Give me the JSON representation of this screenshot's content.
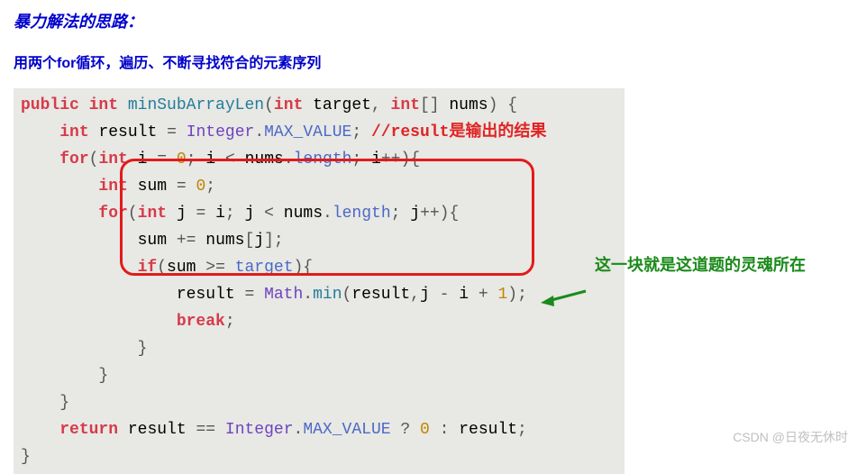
{
  "title": "暴力解法的思路：",
  "subtitle": "用两个for循环，遍历、不断寻找符合的元素序列",
  "annotation": "这一块就是这道题的灵魂所在",
  "watermark": "CSDN @日夜无休时",
  "code": {
    "comment_result": "//result是输出的结果",
    "kw_public": "public",
    "kw_int": "int",
    "method_name": "minSubArrayLen",
    "param_target": "target",
    "param_nums": "nums",
    "var_result": "result",
    "class_integer": "Integer",
    "prop_max": "MAX_VALUE",
    "kw_for": "for",
    "var_i": "i",
    "var_j": "j",
    "num_zero": "0",
    "num_one": "1",
    "prop_length": "length",
    "var_sum": "sum",
    "kw_if": "if",
    "class_math": "Math",
    "method_min": "min",
    "kw_break": "break",
    "kw_return": "return"
  }
}
